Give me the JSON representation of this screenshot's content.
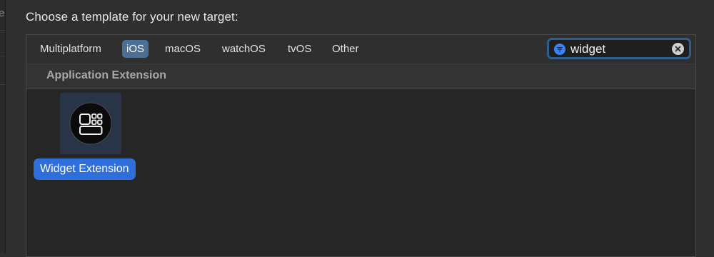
{
  "dialog": {
    "prompt": "Choose a template for your new target:"
  },
  "platform_tabs": {
    "items": [
      {
        "label": "Multiplatform",
        "selected": false
      },
      {
        "label": "iOS",
        "selected": true
      },
      {
        "label": "macOS",
        "selected": false
      },
      {
        "label": "watchOS",
        "selected": false
      },
      {
        "label": "tvOS",
        "selected": false
      },
      {
        "label": "Other",
        "selected": false
      }
    ]
  },
  "filter": {
    "value": "widget",
    "icon": "filter-icon",
    "clear_icon": "clear-icon"
  },
  "sections": [
    {
      "title": "Application Extension",
      "templates": [
        {
          "label": "Widget Extension",
          "icon": "widget-icon",
          "selected": true
        }
      ]
    }
  ],
  "colors": {
    "accent": "#2e6fdc",
    "selected_tab": "#4c6f95",
    "search_ring": "#2f5f8f"
  }
}
